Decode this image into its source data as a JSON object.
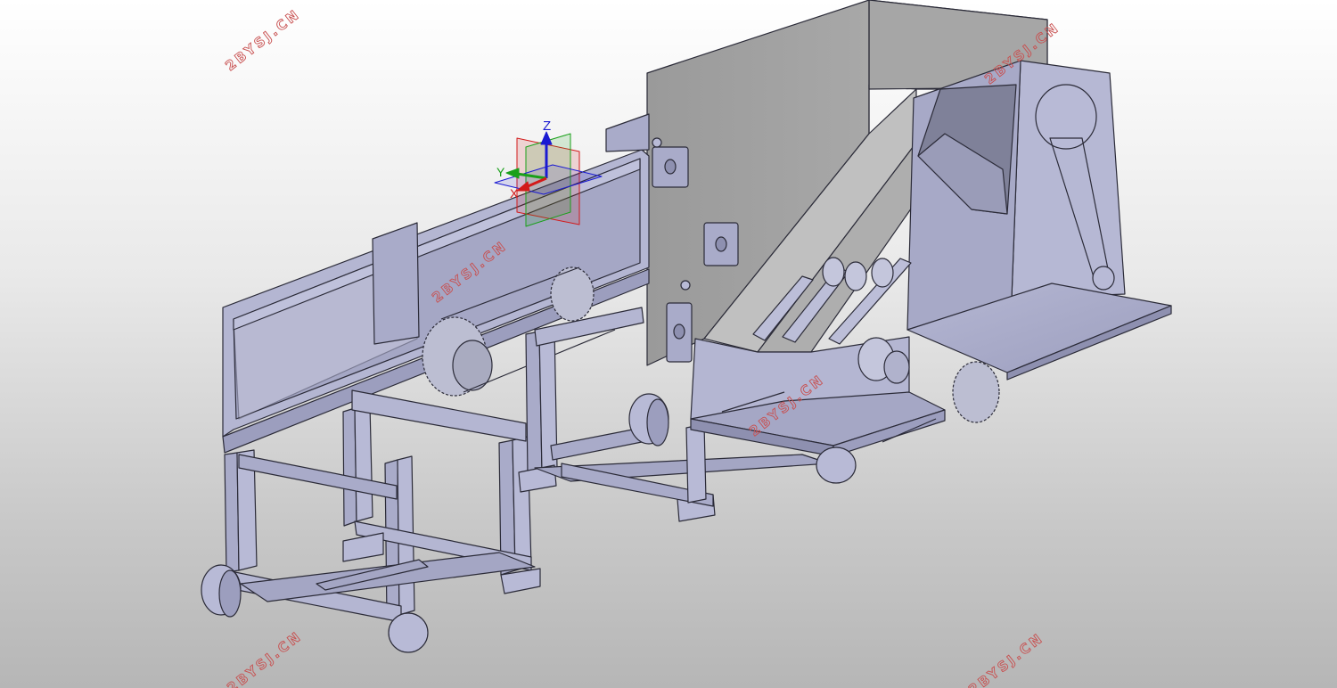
{
  "triad": {
    "z": "Z",
    "y": "Y",
    "x": "X"
  },
  "watermark": "2BYSJ.CN",
  "colors": {
    "part_fill": "#a9abc9",
    "part_fill_light": "#bcbed8",
    "part_fill_dark": "#8e90b0",
    "part_edge": "#2b2b38",
    "watermark": "#c85050",
    "axis_z": "#1a1ad2",
    "axis_y": "#1aa01a",
    "axis_x": "#d21a1a"
  }
}
